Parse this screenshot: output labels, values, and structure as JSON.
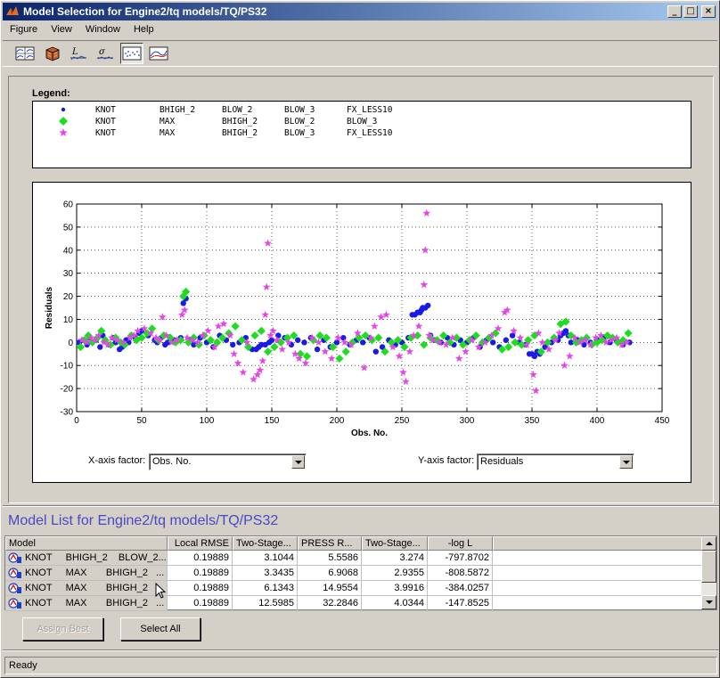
{
  "window": {
    "title": "Model Selection for Engine2/tq models/TQ/PS32",
    "buttons": [
      "_",
      "□",
      "×"
    ]
  },
  "menu": [
    "Figure",
    "View",
    "Window",
    "Help"
  ],
  "toolbar": {
    "tools": [
      "response-surface-view-icon",
      "cube-3d-icon",
      "likelihood-plot-icon",
      "rmse-plot-icon",
      "residuals-plot-icon",
      "cross-section-plot-icon"
    ],
    "selected_tool": "residuals-plot-icon"
  },
  "legend": {
    "title": "Legend:",
    "rows": [
      {
        "marker": "dot",
        "color": "#1a1ae6",
        "terms": [
          "KNOT",
          "BHIGH_2",
          "BLOW_2",
          "BLOW_3",
          "FX_LESS10"
        ]
      },
      {
        "marker": "diamond",
        "color": "#1edc1e",
        "terms": [
          "KNOT",
          "MAX",
          "BHIGH_2",
          "BLOW_2",
          "BLOW_3"
        ]
      },
      {
        "marker": "star",
        "color": "#e646e6",
        "terms": [
          "KNOT",
          "MAX",
          "BHIGH_2",
          "BLOW_3",
          "FX_LESS10"
        ]
      }
    ]
  },
  "chart_data": {
    "type": "scatter",
    "xlabel": "Obs. No.",
    "ylabel": "Residuals",
    "xlim": [
      0,
      450
    ],
    "ylim": [
      -30,
      60
    ],
    "x_ticks": [
      0,
      50,
      100,
      150,
      200,
      250,
      300,
      350,
      400,
      450
    ],
    "y_ticks": [
      -30,
      -20,
      -10,
      0,
      10,
      20,
      30,
      40,
      50,
      60
    ],
    "grid": true,
    "series": [
      {
        "color": "#1a1ae6",
        "marker": "dot",
        "x": [
          2,
          5,
          8,
          10,
          12,
          15,
          18,
          20,
          22,
          25,
          28,
          30,
          33,
          35,
          38,
          40,
          45,
          48,
          50,
          55,
          60,
          62,
          65,
          68,
          70,
          75,
          80,
          82,
          84,
          88,
          90,
          95,
          100,
          105,
          110,
          115,
          120,
          125,
          130,
          135,
          138,
          140,
          142,
          145,
          148,
          150,
          155,
          160,
          165,
          170,
          175,
          180,
          185,
          190,
          195,
          200,
          205,
          210,
          215,
          220,
          225,
          230,
          235,
          240,
          245,
          250,
          255,
          258,
          260,
          262,
          264,
          265,
          266,
          268,
          270,
          272,
          275,
          280,
          285,
          290,
          295,
          300,
          305,
          310,
          315,
          320,
          325,
          330,
          335,
          340,
          345,
          348,
          350,
          352,
          354,
          356,
          360,
          365,
          370,
          372,
          374,
          376,
          378,
          380,
          385,
          390,
          395,
          400,
          405,
          410,
          415,
          420,
          425
        ],
        "y": [
          0,
          1,
          -1,
          2,
          0,
          1,
          -2,
          3,
          1,
          -1,
          2,
          0,
          -3,
          -2,
          1,
          0,
          2,
          4,
          5,
          3,
          1,
          0,
          2,
          -1,
          0,
          1,
          2,
          17,
          19,
          1,
          -1,
          2,
          0,
          -2,
          3,
          1,
          -1,
          0,
          2,
          -3,
          -3,
          -2,
          -1,
          -1,
          0,
          1,
          3,
          2,
          -1,
          1,
          0,
          2,
          -3,
          1,
          -2,
          0,
          2,
          -1,
          1,
          0,
          2,
          -4,
          -2,
          1,
          -1,
          0,
          2,
          12,
          12,
          13,
          13,
          14,
          15,
          15,
          16,
          3,
          1,
          0,
          2,
          -1,
          1,
          0,
          2,
          -2,
          1,
          0,
          -2,
          1,
          3,
          0,
          -1,
          -5,
          -5,
          -6,
          -4,
          -5,
          -2,
          0,
          1,
          3,
          4,
          5,
          3,
          0,
          1,
          -1,
          0,
          1,
          2,
          0,
          1,
          -1,
          0
        ]
      },
      {
        "color": "#1edc1e",
        "marker": "diamond",
        "x": [
          3,
          6,
          9,
          12,
          16,
          19,
          22,
          26,
          30,
          34,
          37,
          42,
          46,
          50,
          54,
          58,
          63,
          67,
          72,
          76,
          80,
          82,
          84,
          86,
          90,
          94,
          98,
          103,
          108,
          112,
          117,
          122,
          127,
          132,
          137,
          142,
          147,
          152,
          157,
          162,
          167,
          172,
          177,
          182,
          187,
          192,
          197,
          202,
          207,
          212,
          217,
          222,
          227,
          232,
          237,
          242,
          247,
          252,
          257,
          262,
          267,
          272,
          277,
          282,
          287,
          292,
          297,
          302,
          307,
          312,
          317,
          322,
          327,
          332,
          337,
          342,
          347,
          352,
          357,
          362,
          367,
          372,
          376,
          380,
          384,
          388,
          392,
          396,
          400,
          404,
          408,
          412,
          416,
          420,
          424
        ],
        "y": [
          -2,
          1,
          3,
          0,
          2,
          5,
          1,
          -1,
          2,
          0,
          -1,
          3,
          1,
          2,
          4,
          6,
          1,
          3,
          2,
          0,
          1,
          20,
          22,
          0,
          2,
          -1,
          3,
          1,
          0,
          2,
          4,
          7,
          1,
          -2,
          3,
          5,
          -4,
          -2,
          0,
          2,
          3,
          -5,
          -6,
          1,
          3,
          2,
          -2,
          -7,
          -4,
          0,
          2,
          3,
          1,
          2,
          -4,
          0,
          1,
          -2,
          2,
          3,
          -1,
          2,
          1,
          3,
          0,
          2,
          -1,
          1,
          3,
          0,
          2,
          4,
          -3,
          -2,
          0,
          -1,
          1,
          3,
          -4,
          0,
          2,
          8,
          9,
          3,
          0,
          1,
          2,
          -1,
          0,
          1,
          3,
          2,
          0,
          1,
          4
        ]
      },
      {
        "color": "#e646e6",
        "marker": "star",
        "x": [
          4,
          8,
          11,
          14,
          17,
          21,
          24,
          27,
          31,
          36,
          41,
          44,
          47,
          52,
          57,
          61,
          64,
          66,
          69,
          73,
          77,
          81,
          83,
          85,
          89,
          93,
          97,
          101,
          106,
          109,
          113,
          118,
          121,
          124,
          128,
          131,
          136,
          139,
          141,
          143,
          145,
          146,
          147,
          149,
          151,
          154,
          158,
          163,
          168,
          171,
          176,
          181,
          186,
          191,
          196,
          201,
          206,
          211,
          216,
          221,
          226,
          229,
          234,
          238,
          243,
          248,
          251,
          253,
          256,
          259,
          263,
          267,
          268,
          269,
          271,
          274,
          279,
          284,
          289,
          294,
          299,
          304,
          309,
          314,
          319,
          324,
          329,
          331,
          336,
          341,
          346,
          351,
          353,
          355,
          358,
          363,
          368,
          371,
          375,
          379,
          383,
          387,
          391,
          395,
          399,
          403,
          407,
          411,
          415,
          419,
          423
        ],
        "y": [
          1,
          0,
          2,
          1,
          3,
          0,
          -1,
          2,
          1,
          0,
          2,
          3,
          5,
          6,
          4,
          2,
          1,
          11,
          3,
          0,
          1,
          12,
          14,
          2,
          1,
          0,
          3,
          5,
          -2,
          7,
          8,
          3,
          -5,
          -9,
          -13,
          0,
          -16,
          -14,
          -12,
          -8,
          12,
          24,
          43,
          3,
          5,
          1,
          -3,
          0,
          -5,
          -7,
          -9,
          2,
          0,
          -4,
          -7,
          2,
          0,
          -1,
          4,
          -11,
          2,
          7,
          11,
          12,
          -2,
          -6,
          -13,
          -17,
          -4,
          3,
          7,
          25,
          40,
          56,
          3,
          1,
          0,
          -1,
          2,
          -7,
          -4,
          1,
          -2,
          0,
          3,
          6,
          13,
          14,
          5,
          2,
          -1,
          -14,
          -21,
          4,
          0,
          -3,
          1,
          4,
          -10,
          -6,
          2,
          0,
          1,
          -1,
          2,
          3,
          0,
          1,
          2,
          -1,
          0
        ]
      }
    ]
  },
  "factors": {
    "x_label": "X-axis factor:",
    "x_value": "Obs. No.",
    "y_label": "Y-axis factor:",
    "y_value": "Residuals"
  },
  "model_list": {
    "title": "Model List for Engine2/tq models/TQ/PS32",
    "columns": [
      "Model",
      "Local RMSE",
      "Two-Stage...",
      "PRESS R...",
      "Two-Stage...",
      "-log L"
    ],
    "rows": [
      {
        "model": "KNOT     BHIGH_2    BLOW_2...",
        "local_rmse": "0.19889",
        "two_stage_1": "3.1044",
        "press": "5.5586",
        "two_stage_2": "3.274",
        "log_l": "-797.8702"
      },
      {
        "model": "KNOT     MAX       BHIGH_2   ...",
        "local_rmse": "0.19889",
        "two_stage_1": "3.3435",
        "press": "6.9068",
        "two_stage_2": "2.9355",
        "log_l": "-808.5872"
      },
      {
        "model": "KNOT     MAX       BHIGH_2   ...",
        "local_rmse": "0.19889",
        "two_stage_1": "6.1343",
        "press": "14.9554",
        "two_stage_2": "3.9916",
        "log_l": "-384.0257"
      },
      {
        "model": "KNOT     MAX       BHIGH_2   ...",
        "local_rmse": "0.19889",
        "two_stage_1": "12.5985",
        "press": "32.2846",
        "two_stage_2": "4.0344",
        "log_l": "-147.8525"
      }
    ]
  },
  "buttons": {
    "assign_best": "Assign Best",
    "select_all": "Select All"
  },
  "status": "Ready"
}
